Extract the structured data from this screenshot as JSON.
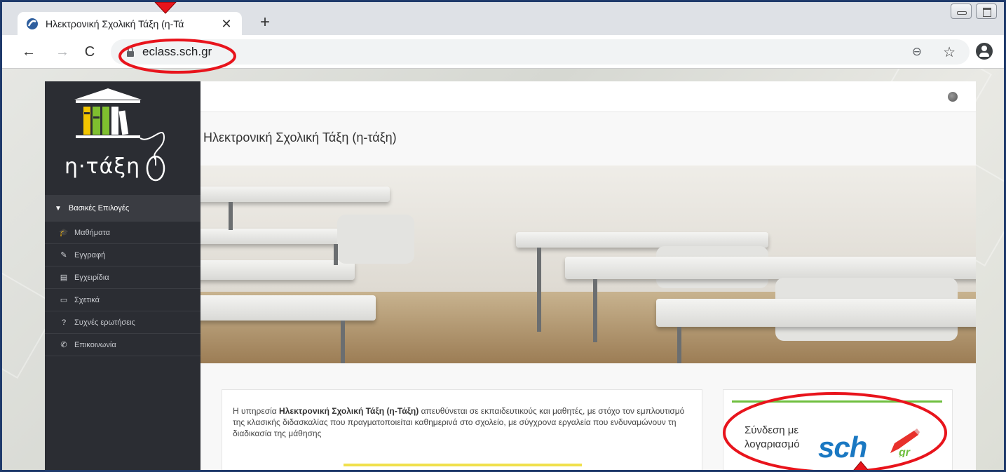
{
  "browser": {
    "tab_title": "Ηλεκτρονική Σχολική Τάξη (η-Τά",
    "tab_close": "✕",
    "new_tab": "+",
    "url": "eclass.sch.gr",
    "back": "←",
    "forward": "→",
    "reload": "C",
    "zoom": "⊖",
    "bookmark": "☆"
  },
  "sidebar": {
    "logo_text": "η·τάξη",
    "section_label": "Βασικές Επιλογές",
    "items": [
      {
        "label": "Μαθήματα",
        "icon": "graduation-cap-icon",
        "glyph": "🎓"
      },
      {
        "label": "Εγγραφή",
        "icon": "edit-icon",
        "glyph": "✎"
      },
      {
        "label": "Εγχειρίδια",
        "icon": "document-icon",
        "glyph": "▤"
      },
      {
        "label": "Σχετικά",
        "icon": "card-icon",
        "glyph": "▭"
      },
      {
        "label": "Συχνές ερωτήσεις",
        "icon": "question-icon",
        "glyph": "?"
      },
      {
        "label": "Επικοινωνία",
        "icon": "phone-icon",
        "glyph": "✆"
      }
    ]
  },
  "main": {
    "title": "Ηλεκτρονική Σχολική Τάξη (η-τάξη)",
    "description_prefix": "Η υπηρεσία ",
    "description_bold": "Ηλεκτρονική Σχολική Τάξη (η-Τάξη)",
    "description_suffix": " απευθύνεται σε εκπαιδευτικούς και μαθητές, με στόχο τον εμπλουτισμό της κλασικής διδασκαλίας που πραγματοποιείται καθημερινά στο σχολείο, με σύγχρονα εργαλεία που ενδυναμώνουν τη διαδικασία της μάθησης",
    "login_line1": "Σύνδεση με",
    "login_line2": "λογαριασμό",
    "sch_logo": "sch"
  },
  "colors": {
    "sidebar_bg": "#2b2d33",
    "annotation": "#e8141c",
    "sch_blue": "#1a78c2",
    "accent_green": "#6fbf3f",
    "accent_yellow": "#f0e04c"
  }
}
